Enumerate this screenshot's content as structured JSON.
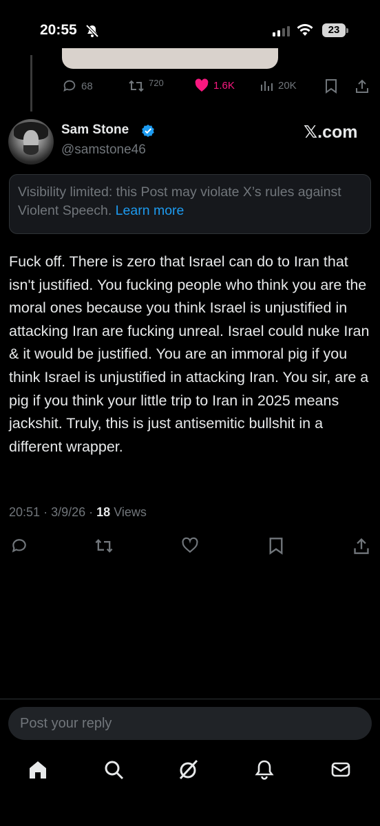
{
  "status_bar": {
    "time": "20:55",
    "battery": "23",
    "icons": [
      "bell-off-icon",
      "signal-icon",
      "wifi-icon",
      "battery-icon"
    ]
  },
  "previous_post": {
    "replies": "68",
    "reposts": "720",
    "likes": "1.6K",
    "views": "20K",
    "like_color": "#f91880"
  },
  "post": {
    "author_name": "Sam Stone",
    "author_handle": "@samstone46",
    "brand_label": "𝕏.com",
    "notice_text": "Visibility limited: this Post may violate X’s rules against Violent Speech.",
    "notice_link": "Learn more",
    "text": "Fuck off. There is zero that Israel can do to Iran that isn't justified. You fucking people who think you are the moral ones because you think Israel is unjustified in attacking Iran are fucking unreal. Israel could nuke Iran & it would be justified. You are an immoral pig if you think Israel is unjustified in attacking Iran. You sir, are a pig if you think your little trip to Iran in 2025 means jackshit. Truly, this is just antisemitic bullshit in a different wrapper.",
    "time": "20:51",
    "date": "3/9/26",
    "views_count": "18",
    "views_label": "Views",
    "sep": "·"
  },
  "reply": {
    "placeholder": "Post your reply"
  },
  "nav": {
    "items": [
      "home-icon",
      "search-icon",
      "grok-icon",
      "notifications-icon",
      "messages-icon"
    ]
  },
  "colors": {
    "background": "#000000",
    "text": "#e7e9ea",
    "muted": "#71767b",
    "link": "#1d9bf0",
    "verified": "#1d9bf0"
  }
}
